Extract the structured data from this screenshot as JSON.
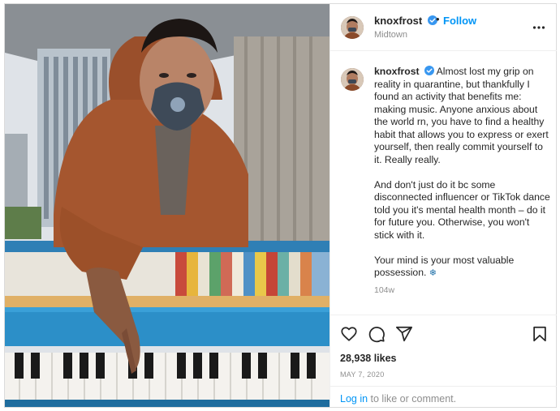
{
  "post": {
    "username": "knoxfrost",
    "follow_label": "Follow",
    "separator": "•",
    "location": "Midtown",
    "caption_paragraphs": [
      "Almost lost my grip on reality in quarantine, but thankfully I found an activity that benefits me: making music. Anyone anxious about the world rn, you have to find a healthy habit that allows you to express or exert yourself, then really commit yourself to it. Really really.",
      "And don't just do it bc some disconnected influencer or TikTok dance told you it's mental health month – do it for future you. Otherwise, you won't stick with it.",
      "Your mind is your most valuable possession."
    ],
    "caption_emoji": "❄",
    "time_ago": "104w",
    "likes": "28,938 likes",
    "date": "MAY 7, 2020",
    "login_link": "Log in",
    "login_suffix": " to like or comment."
  },
  "icons": {
    "verified": "verified-badge-icon",
    "more": "more-options-icon",
    "like": "heart-icon",
    "comment": "comment-icon",
    "share": "share-icon",
    "save": "bookmark-icon"
  },
  "colors": {
    "link_blue": "#0095f6",
    "verified_blue": "#3897f0",
    "muted": "#8e8e8e",
    "text": "#262626"
  }
}
